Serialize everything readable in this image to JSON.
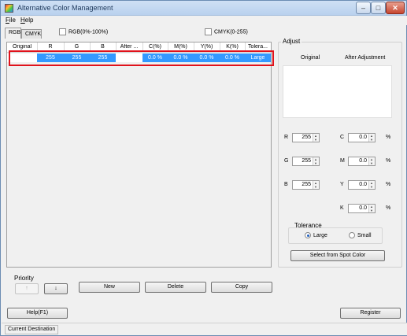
{
  "window": {
    "title": "Alternative Color Management",
    "controls": {
      "minimize": "–",
      "maximize": "□",
      "close": "✕"
    }
  },
  "menu": [
    "File",
    "Help"
  ],
  "tabs": [
    {
      "label": "RGB",
      "active": true
    },
    {
      "label": "CMYK",
      "active": false
    }
  ],
  "options": {
    "rgb_percent": {
      "label": "RGB(0%-100%)",
      "checked": false
    },
    "cmyk_255": {
      "label": "CMYK(0-255)",
      "checked": false
    }
  },
  "table": {
    "columns": [
      "Original",
      "R",
      "G",
      "B",
      "After ...",
      "C(%)",
      "M(%)",
      "Y(%)",
      "K(%)",
      "Tolera..."
    ],
    "rows": [
      {
        "original": "",
        "r": "255",
        "g": "255",
        "b": "255",
        "after": "",
        "c": "0.0 %",
        "m": "0.0 %",
        "y": "0.0 %",
        "k": "0.0 %",
        "tolerance": "Large",
        "selected": true
      }
    ]
  },
  "adjust": {
    "title": "Adjust",
    "original_label": "Original",
    "after_label": "After Adjustment",
    "fields": {
      "r": {
        "label": "R",
        "value": "255"
      },
      "g": {
        "label": "G",
        "value": "255"
      },
      "b": {
        "label": "B",
        "value": "255"
      },
      "c": {
        "label": "C",
        "value": "0.0",
        "unit": "%"
      },
      "m": {
        "label": "M",
        "value": "0.0",
        "unit": "%"
      },
      "y": {
        "label": "Y",
        "value": "0.0",
        "unit": "%"
      },
      "k": {
        "label": "K",
        "value": "0.0",
        "unit": "%"
      }
    },
    "tolerance": {
      "label": "Tolerance",
      "large": "Large",
      "small": "Small",
      "selected": "Large"
    },
    "spot_button": "Select from Spot Color"
  },
  "priority": {
    "label": "Priority",
    "up": "↑",
    "down": "↓"
  },
  "actions": {
    "new": "New",
    "delete": "Delete",
    "copy": "Copy"
  },
  "footer": {
    "help": "Help(F1)",
    "register": "Register"
  },
  "status": {
    "text": "Current Destination"
  },
  "colors": {
    "selection": "#3399ff",
    "highlight_border": "#e0121b",
    "titlebar": "#c5d9f1"
  }
}
